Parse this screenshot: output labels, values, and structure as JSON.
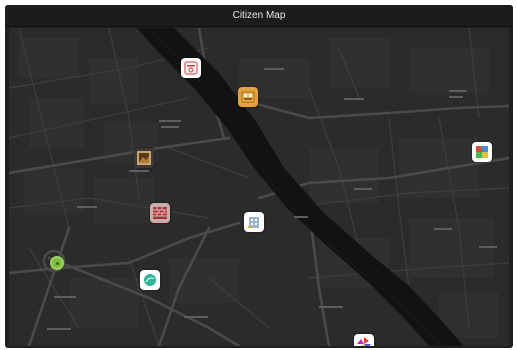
{
  "window": {
    "title": "Citizen Map"
  },
  "map": {
    "pois": [
      {
        "id": "restaurant-poi",
        "icon": "restaurant-logo-icon"
      },
      {
        "id": "shop-poi",
        "icon": "shop-icon"
      },
      {
        "id": "gallery-poi",
        "icon": "photo-frame-icon"
      },
      {
        "id": "colorful-poi",
        "icon": "colorful-grid-icon"
      },
      {
        "id": "bricks-poi",
        "icon": "bricks-icon"
      },
      {
        "id": "building-poi",
        "icon": "building-icon"
      },
      {
        "id": "teal-poi",
        "icon": "teal-leaf-icon"
      },
      {
        "id": "pinwheel-poi",
        "icon": "pinwheel-icon"
      }
    ],
    "current_location": {
      "icon": "location-marker-icon"
    },
    "colors": {
      "background": "#2b2b2b",
      "river": "#111111",
      "roads": "#454545",
      "location": "#7bbf3a"
    }
  }
}
